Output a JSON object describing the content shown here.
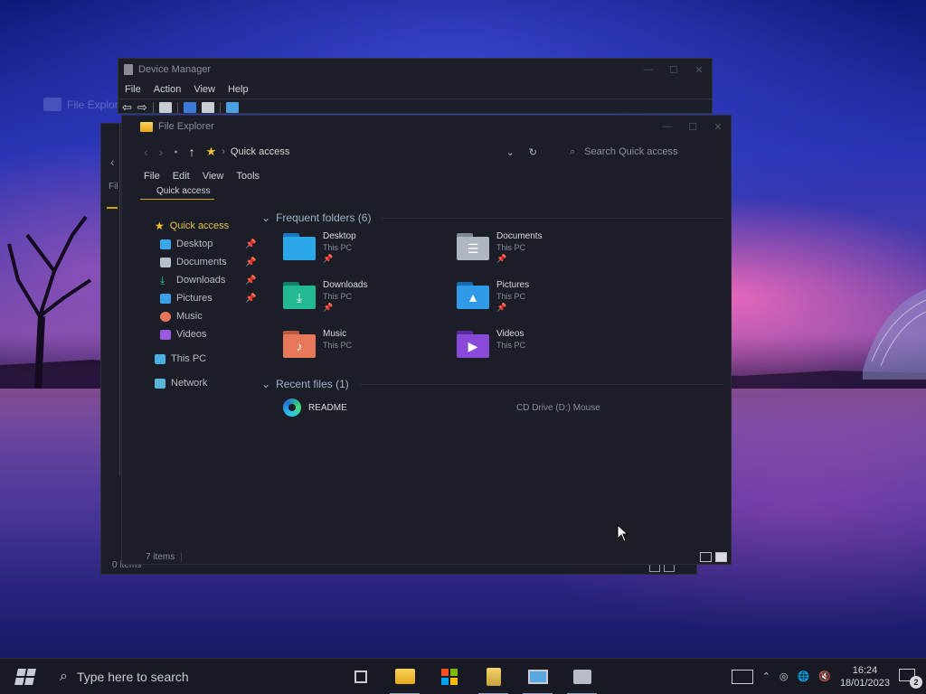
{
  "desktop": {
    "ghost_label": "File Explorer"
  },
  "device_manager": {
    "title": "Device Manager",
    "menu": [
      "File",
      "Action",
      "View",
      "Help"
    ],
    "controls": [
      "—",
      "☐",
      "✕"
    ]
  },
  "explorer_back": {
    "status": "0 items",
    "fragment": "Fil"
  },
  "explorer": {
    "title": "File Explorer",
    "controls": [
      "—",
      "☐",
      "✕"
    ],
    "address": "Quick access",
    "search_placeholder": "Search Quick access",
    "menu": [
      "File",
      "Edit",
      "View",
      "Tools"
    ],
    "active_tab": "Quick access",
    "sidebar": {
      "quick_access": "Quick access",
      "items": [
        {
          "label": "Desktop",
          "pinned": true,
          "icon": "desktop-icon",
          "color": "#3aa8e8"
        },
        {
          "label": "Documents",
          "pinned": true,
          "icon": "documents-icon",
          "color": "#b8c0cc"
        },
        {
          "label": "Downloads",
          "pinned": true,
          "icon": "downloads-icon",
          "color": "#2ec99a"
        },
        {
          "label": "Pictures",
          "pinned": true,
          "icon": "pictures-icon",
          "color": "#3aa0e8"
        },
        {
          "label": "Music",
          "pinned": false,
          "icon": "music-icon",
          "color": "#e8765a"
        },
        {
          "label": "Videos",
          "pinned": false,
          "icon": "videos-icon",
          "color": "#9a5ae0"
        }
      ],
      "this_pc": "This PC",
      "network": "Network"
    },
    "frequent": {
      "header": "Frequent folders (6)",
      "folders": [
        {
          "name": "Desktop",
          "location": "This PC",
          "pinned": true,
          "color": "#2aa8e8",
          "glyph": ""
        },
        {
          "name": "Documents",
          "location": "This PC",
          "pinned": true,
          "color": "#aeb6c2",
          "glyph": "☰"
        },
        {
          "name": "Downloads",
          "location": "This PC",
          "pinned": true,
          "color": "#22b890",
          "glyph": "⤓"
        },
        {
          "name": "Pictures",
          "location": "This PC",
          "pinned": true,
          "color": "#2e9ae8",
          "glyph": "▲"
        },
        {
          "name": "Music",
          "location": "This PC",
          "pinned": false,
          "color": "#e8785a",
          "glyph": "♪"
        },
        {
          "name": "Videos",
          "location": "This PC",
          "pinned": false,
          "color": "#8a4ad8",
          "glyph": "▶"
        }
      ]
    },
    "recent": {
      "header": "Recent files (1)",
      "files": [
        {
          "name": "README",
          "location": "CD Drive (D:) Mouse"
        }
      ]
    },
    "status": "7 items"
  },
  "taskbar": {
    "search_placeholder": "Type here to search",
    "apps": [
      "task-view-icon",
      "file-explorer-icon",
      "microsoft-store-icon",
      "notepad-icon",
      "remote-desktop-icon",
      "device-manager-icon"
    ],
    "time": "16:24",
    "date": "18/01/2023",
    "notifications": "2"
  }
}
